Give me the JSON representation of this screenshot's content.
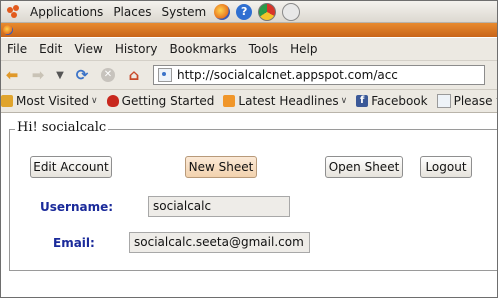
{
  "system_panel": {
    "menus": [
      "Applications",
      "Places",
      "System"
    ],
    "launchers": [
      "firefox-icon",
      "help-icon",
      "chrome-icon",
      "speaker-icon"
    ]
  },
  "browser": {
    "menu": [
      "File",
      "Edit",
      "View",
      "History",
      "Bookmarks",
      "Tools",
      "Help"
    ],
    "url": "http://socialcalcnet.appspot.com/acc",
    "bookmarks": [
      {
        "label": "Most Visited",
        "icon": "folder-icon",
        "dropdown": true
      },
      {
        "label": "Getting Started",
        "icon": "getting-started-icon",
        "dropdown": false
      },
      {
        "label": "Latest Headlines",
        "icon": "rss-icon",
        "dropdown": true
      },
      {
        "label": "Facebook",
        "icon": "facebook-icon",
        "dropdown": false
      },
      {
        "label": "Please type your",
        "icon": "page-icon",
        "dropdown": false
      }
    ]
  },
  "page": {
    "greeting": "Hi! socialcalc",
    "buttons": {
      "edit_account": "Edit Account",
      "new_sheet": "New Sheet",
      "open_sheet": "Open Sheet",
      "logout": "Logout"
    },
    "username_label": "Username:",
    "username_value": "socialcalc",
    "email_label": "Email:",
    "email_value": "socialcalc.seeta@gmail.com"
  },
  "colors": {
    "label_blue": "#1a2a9a",
    "titlebar_orange": "#d9761f",
    "new_sheet_bg": "#f6ddc0"
  }
}
